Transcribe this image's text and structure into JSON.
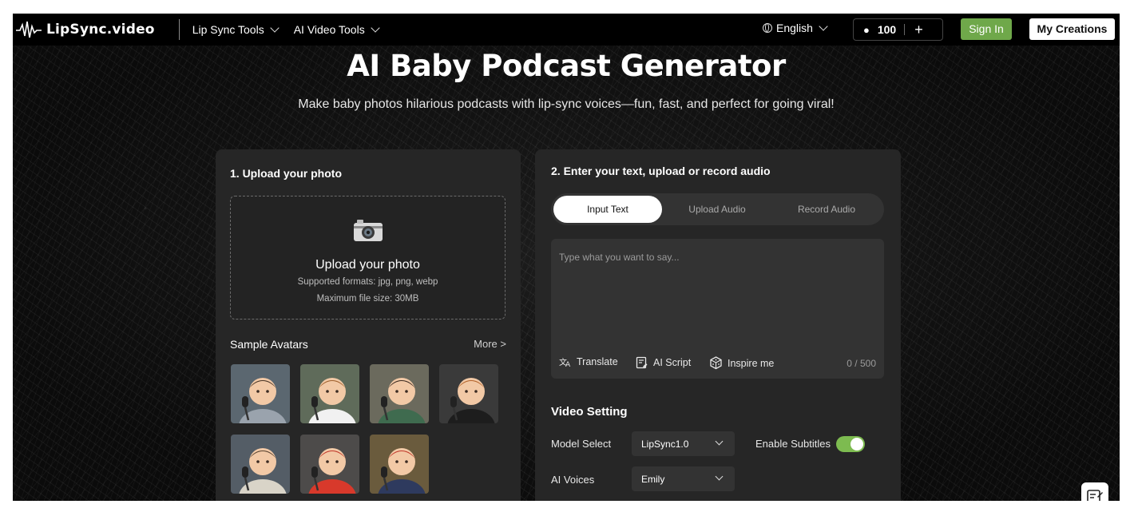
{
  "header": {
    "logo_text": "LipSync.video",
    "nav": [
      {
        "label": "Lip Sync Tools"
      },
      {
        "label": "AI Video Tools"
      }
    ],
    "language": "English",
    "credits": "100",
    "plus": "+",
    "sign_in": "Sign In",
    "my_creations": "My Creations"
  },
  "hero": {
    "title": "AI Baby Podcast Generator",
    "subtitle": "Make baby photos hilarious podcasts with lip-sync voices—fun, fast, and perfect for going viral!"
  },
  "upload_panel": {
    "title": "1. Upload your photo",
    "box_title": "Upload your photo",
    "formats": "Supported formats: jpg, png, webp",
    "max_size": "Maximum file size: 30MB",
    "samples_label": "Sample Avatars",
    "more": "More >",
    "avatars": [
      {
        "shirt": "#9aa3ad",
        "bg": "#5b6770",
        "hair": "#4a3526"
      },
      {
        "shirt": "#f1f1f1",
        "bg": "#5f6b5a",
        "hair": "#a0612e"
      },
      {
        "shirt": "#3f6b4f",
        "bg": "#6b6a5d",
        "hair": "#3c2a20"
      },
      {
        "shirt": "#1d1d1d",
        "bg": "#3a3a3a",
        "hair": "#b5652d"
      },
      {
        "shirt": "#d9d4c8",
        "bg": "#545d66",
        "hair": "#5a4330"
      },
      {
        "shirt": "#d8392b",
        "bg": "#4d4b4a",
        "hair": "#c0392b"
      },
      {
        "shirt": "#2e3a5e",
        "bg": "#6a5b3d",
        "hair": "#c0392b"
      }
    ]
  },
  "audio_panel": {
    "title": "2. Enter your text, upload or record audio",
    "tabs": [
      "Input Text",
      "Upload Audio",
      "Record Audio"
    ],
    "placeholder": "Type what you want to say...",
    "tools": {
      "translate": "Translate",
      "ai_script": "AI Script",
      "inspire": "Inspire me"
    },
    "counter": "0 / 500",
    "video_setting": "Video Setting",
    "model_label": "Model Select",
    "model_value": "LipSync1.0",
    "subtitles_label": "Enable Subtitles",
    "subtitles_enabled": true,
    "voices_label": "AI Voices",
    "voice_value": "Emily"
  },
  "colors": {
    "accent_green": "#6fa84a",
    "toggle_green": "#7dbb50",
    "panel_bg": "#262626"
  }
}
